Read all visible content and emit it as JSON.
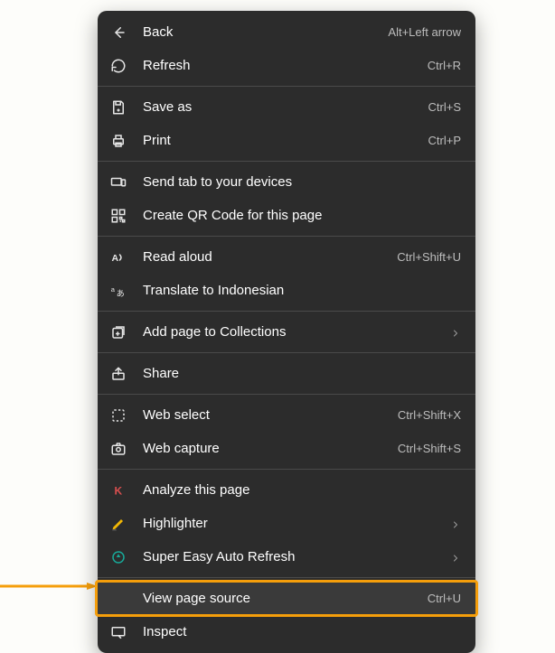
{
  "annotation": {
    "arrow_color": "#f59e0b"
  },
  "menu": {
    "highlight_color": "#f59e0b",
    "groups": [
      [
        {
          "id": "back",
          "label": "Back",
          "shortcut": "Alt+Left arrow"
        },
        {
          "id": "refresh",
          "label": "Refresh",
          "shortcut": "Ctrl+R"
        }
      ],
      [
        {
          "id": "save-as",
          "label": "Save as",
          "shortcut": "Ctrl+S"
        },
        {
          "id": "print",
          "label": "Print",
          "shortcut": "Ctrl+P"
        }
      ],
      [
        {
          "id": "send-tab",
          "label": "Send tab to your devices"
        },
        {
          "id": "qr-code",
          "label": "Create QR Code for this page"
        }
      ],
      [
        {
          "id": "read-aloud",
          "label": "Read aloud",
          "shortcut": "Ctrl+Shift+U"
        },
        {
          "id": "translate",
          "label": "Translate to Indonesian"
        }
      ],
      [
        {
          "id": "collections",
          "label": "Add page to Collections",
          "submenu": true
        }
      ],
      [
        {
          "id": "share",
          "label": "Share"
        }
      ],
      [
        {
          "id": "web-select",
          "label": "Web select",
          "shortcut": "Ctrl+Shift+X"
        },
        {
          "id": "web-capture",
          "label": "Web capture",
          "shortcut": "Ctrl+Shift+S"
        }
      ],
      [
        {
          "id": "analyze",
          "label": "Analyze this page"
        },
        {
          "id": "highlighter",
          "label": "Highlighter",
          "submenu": true
        },
        {
          "id": "auto-refresh",
          "label": "Super Easy Auto Refresh",
          "submenu": true
        }
      ],
      [
        {
          "id": "view-source",
          "label": "View page source",
          "shortcut": "Ctrl+U",
          "highlighted": true
        },
        {
          "id": "inspect",
          "label": "Inspect"
        }
      ]
    ]
  }
}
